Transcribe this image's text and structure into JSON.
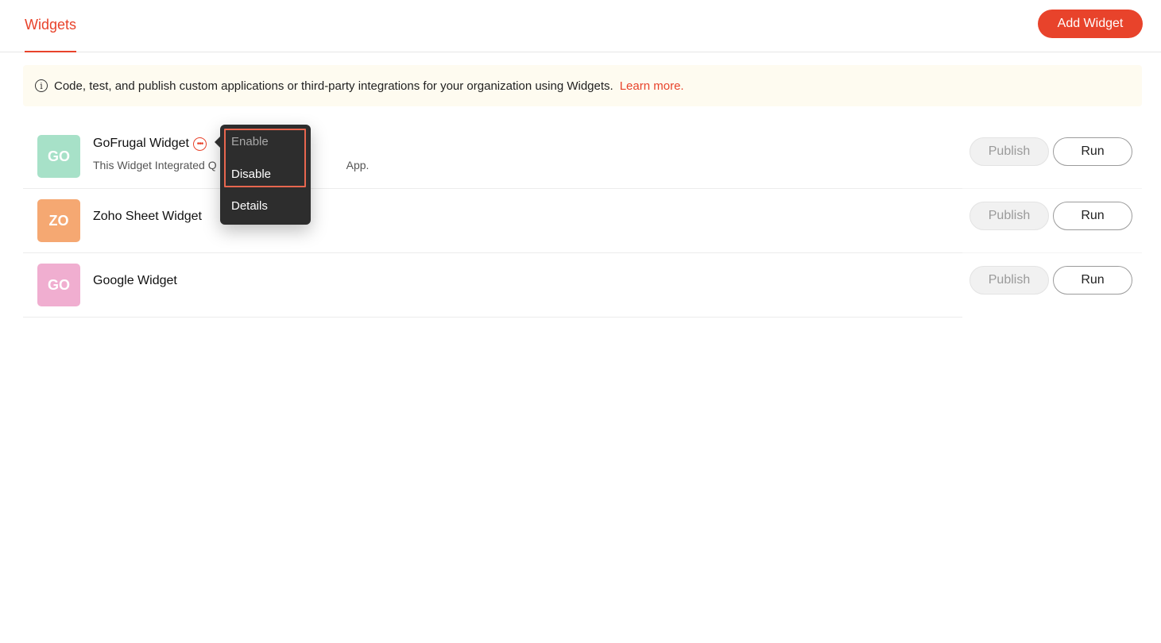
{
  "header": {
    "tab_label": "Widgets",
    "add_button_label": "Add Widget"
  },
  "banner": {
    "icon": "info-icon",
    "text": "Code, test, and publish custom applications or third-party integrations for your organization using Widgets.",
    "link_text": "Learn more."
  },
  "widgets": [
    {
      "initials": "GO",
      "avatar_color": "#a7e1c8",
      "name": "GoFrugal Widget",
      "desc_start": "This Widget Integrated Q",
      "desc_end": "App.",
      "publish_label": "Publish",
      "run_label": "Run"
    },
    {
      "initials": "ZO",
      "avatar_color": "#f5a872",
      "name": "Zoho Sheet Widget",
      "publish_label": "Publish",
      "run_label": "Run"
    },
    {
      "initials": "GO",
      "avatar_color": "#f0aed0",
      "name": "Google Widget",
      "publish_label": "Publish",
      "run_label": "Run"
    }
  ],
  "context_menu": {
    "items": [
      {
        "label": "Enable",
        "disabled": true
      },
      {
        "label": "Disable",
        "disabled": false
      },
      {
        "label": "Details",
        "disabled": false
      }
    ],
    "highlight_color": "#e8664f"
  },
  "colors": {
    "accent": "#e8432b",
    "banner_bg": "#fefbf0",
    "menu_bg": "#2d2d2d"
  }
}
